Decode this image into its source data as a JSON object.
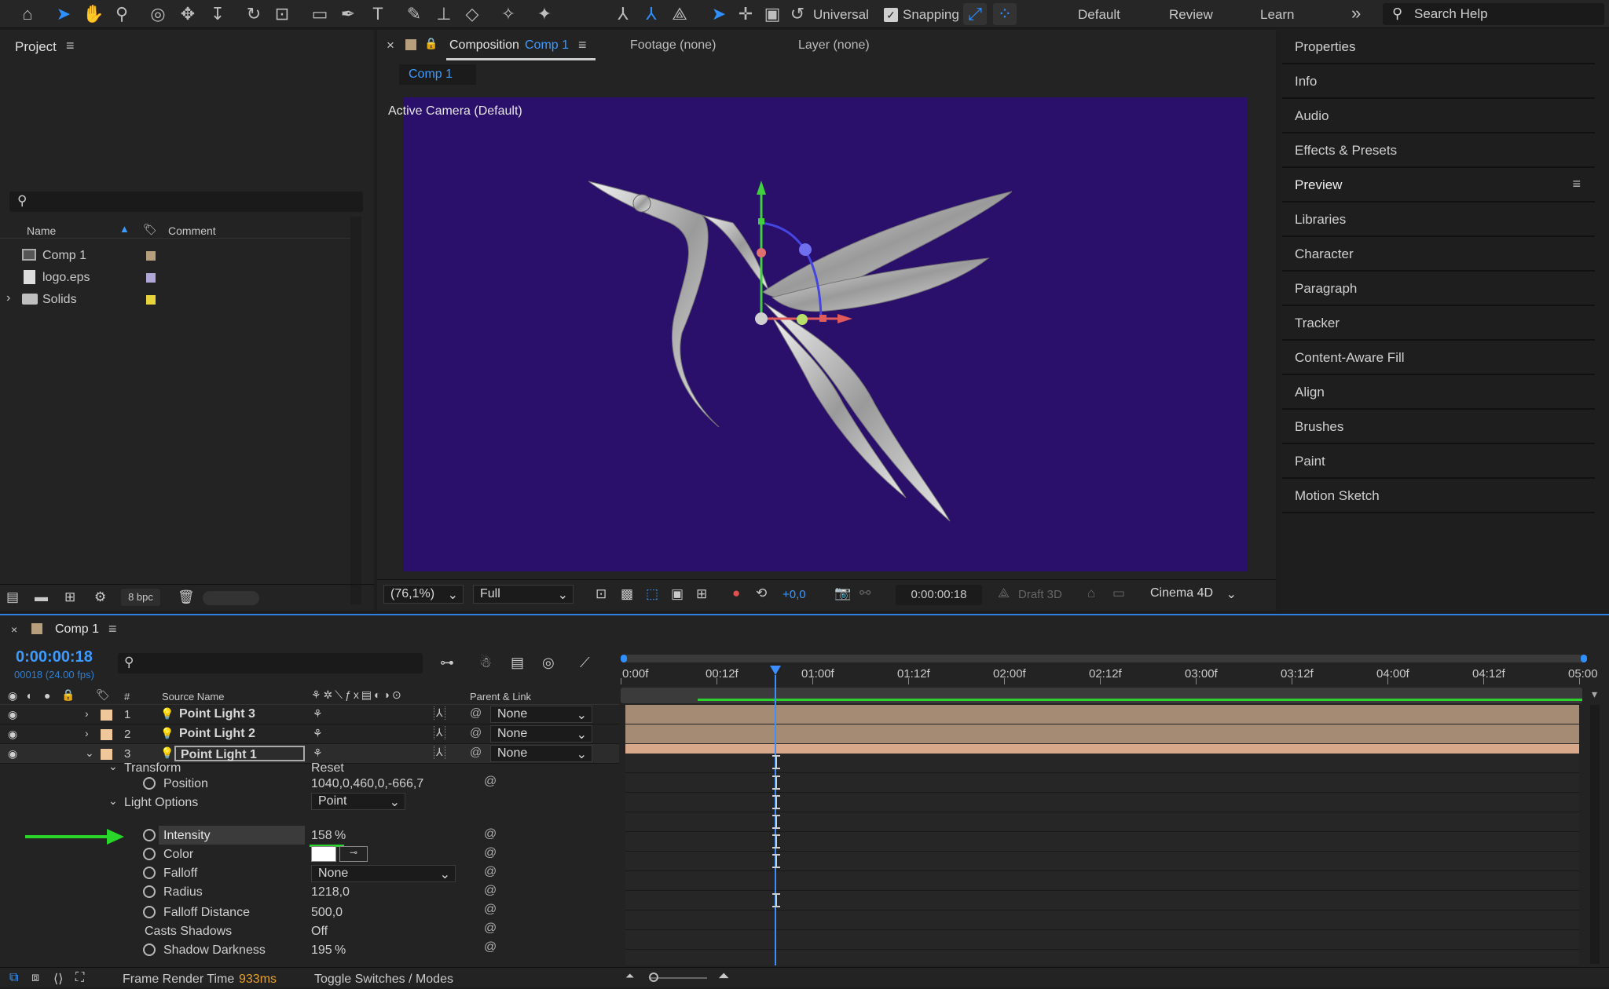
{
  "toolbar": {
    "universal": "Universal",
    "snapping": "Snapping",
    "workspaces": [
      "Default",
      "Review",
      "Learn"
    ],
    "more": "»",
    "search_placeholder": "Search Help"
  },
  "project": {
    "title": "Project",
    "search_placeholder": "",
    "col_name": "Name",
    "col_comment": "Comment",
    "items": [
      {
        "name": "Comp 1",
        "color": "#b79e7c"
      },
      {
        "name": "logo.eps",
        "color": "#b1a7d6"
      },
      {
        "name": "Solids",
        "color": "#e8d43a"
      }
    ],
    "bpc": "8 bpc"
  },
  "composition": {
    "close": "×",
    "tab_label": "Composition",
    "tab_comp": "Comp 1",
    "footage": "Footage (none)",
    "layer": "Layer (none)",
    "subtab": "Comp 1",
    "camera": "Active Camera (Default)",
    "bg_color": "#2a0f6b"
  },
  "viewer_bar": {
    "zoom": "(76,1%)",
    "resolution": "Full",
    "exposure": "+0,0",
    "timecode": "0:00:00:18",
    "draft3d": "Draft 3D",
    "renderer": "Cinema 4D"
  },
  "right_panel": {
    "items": [
      "Properties",
      "Info",
      "Audio",
      "Effects & Presets",
      "Preview",
      "Libraries",
      "Character",
      "Paragraph",
      "Tracker",
      "Content-Aware Fill",
      "Align",
      "Brushes",
      "Paint",
      "Motion Sketch"
    ]
  },
  "timeline": {
    "comp_name": "Comp 1",
    "timecode": "0:00:00:18",
    "frames": "00018 (24.00 fps)",
    "col_num": "#",
    "col_source": "Source Name",
    "col_parent": "Parent & Link",
    "ruler": [
      "0:00f",
      "00:12f",
      "01:00f",
      "01:12f",
      "02:00f",
      "02:12f",
      "03:00f",
      "03:12f",
      "04:00f",
      "04:12f",
      "05:00"
    ],
    "layers": [
      {
        "num": "1",
        "name": "Point Light 3",
        "parent": "None"
      },
      {
        "num": "2",
        "name": "Point Light 2",
        "parent": "None"
      },
      {
        "num": "3",
        "name": "Point Light 1",
        "parent": "None"
      }
    ],
    "transform": "Transform",
    "reset": "Reset",
    "position_label": "Position",
    "position_value": "1040,0,460,0,-666,7",
    "light_options": "Light Options",
    "light_type": "Point",
    "intensity_label": "Intensity",
    "intensity_value": "158",
    "intensity_unit": "%",
    "color_label": "Color",
    "falloff_label": "Falloff",
    "falloff_value": "None",
    "radius_label": "Radius",
    "radius_value": "1218,0",
    "falloff_distance_label": "Falloff Distance",
    "falloff_distance_value": "500,0",
    "casts_shadows_label": "Casts Shadows",
    "casts_shadows_value": "Off",
    "shadow_darkness_label": "Shadow Darkness",
    "shadow_darkness_value": "195",
    "shadow_darkness_unit": "%",
    "frame_render_label": "Frame Render Time",
    "frame_render_value": "933ms",
    "toggle": "Toggle Switches / Modes"
  }
}
